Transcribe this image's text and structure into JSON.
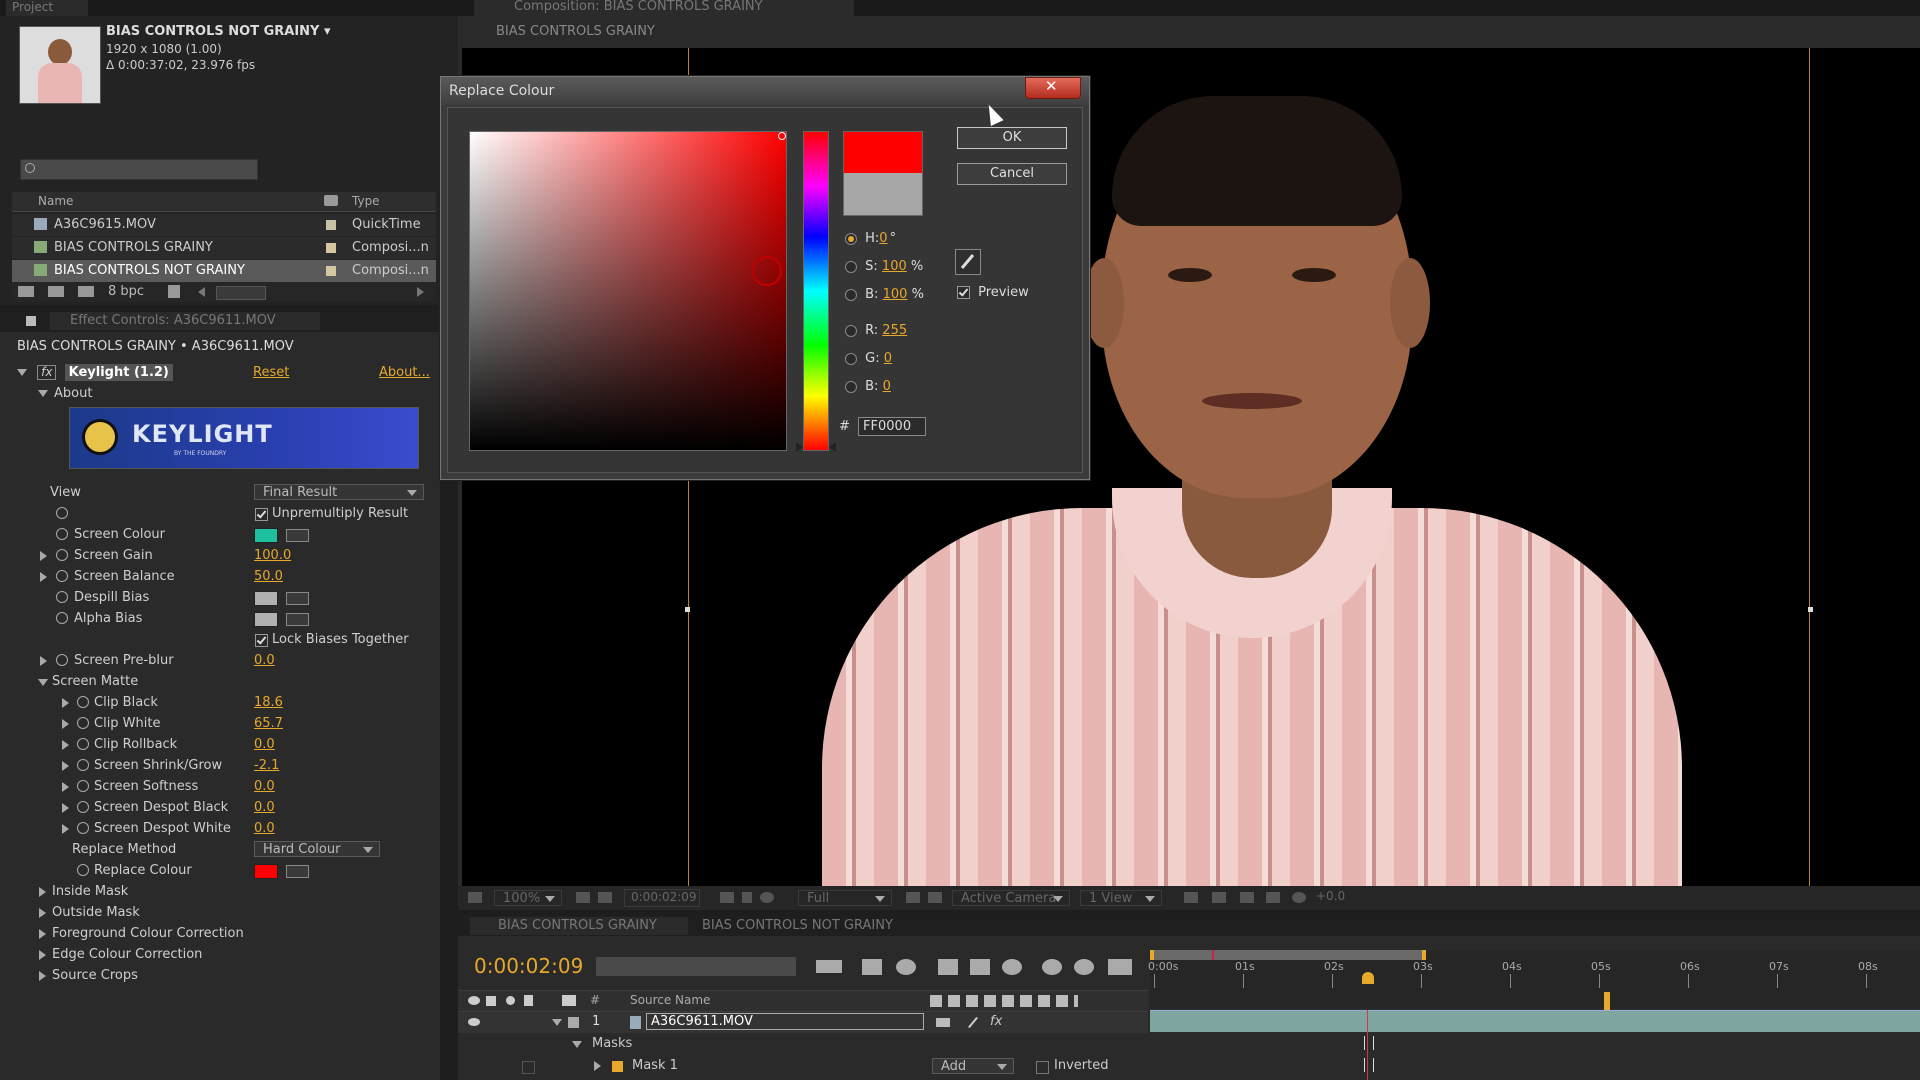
{
  "project": {
    "tab_label": "Project",
    "comp_name": "BIAS CONTROLS NOT GRAINY ▾",
    "comp_size": "1920 x 1080 (1.00)",
    "comp_duration": "Δ 0:00:37:02, 23.976 fps",
    "col_name": "Name",
    "col_type": "Type",
    "items": [
      {
        "name": "A36C9615.MOV",
        "type": "QuickTime"
      },
      {
        "name": "BIAS CONTROLS GRAINY",
        "type": "Composi...n"
      },
      {
        "name": "BIAS CONTROLS NOT GRAINY",
        "type": "Composi...n"
      }
    ],
    "bpc": "8 bpc"
  },
  "effect_controls": {
    "tab_label": "Effect Controls: A36C9611.MOV",
    "breadcrumb": "BIAS CONTROLS GRAINY • A36C9611.MOV",
    "effect_name": "Keylight (1.2)",
    "reset": "Reset",
    "about_link": "About...",
    "about_group": "About",
    "logo_text": "KEYLIGHT",
    "logo_sub": "BY THE FOUNDRY",
    "view_label": "View",
    "view_value": "Final Result",
    "unpremultiply": "Unpremultiply Result",
    "screen_colour": "Screen Colour",
    "screen_gain": "Screen Gain",
    "screen_gain_val": "100.0",
    "screen_balance": "Screen Balance",
    "screen_balance_val": "50.0",
    "despill_bias": "Despill Bias",
    "alpha_bias": "Alpha Bias",
    "lock_biases": "Lock Biases Together",
    "screen_preblur": "Screen Pre-blur",
    "screen_preblur_val": "0.0",
    "screen_matte": "Screen Matte",
    "clip_black": "Clip Black",
    "clip_black_val": "18.6",
    "clip_white": "Clip White",
    "clip_white_val": "65.7",
    "clip_rollback": "Clip Rollback",
    "clip_rollback_val": "0.0",
    "shrink_grow": "Screen Shrink/Grow",
    "shrink_grow_val": "-2.1",
    "softness": "Screen Softness",
    "softness_val": "0.0",
    "despot_black": "Screen Despot Black",
    "despot_black_val": "0.0",
    "despot_white": "Screen Despot White",
    "despot_white_val": "0.0",
    "replace_method": "Replace Method",
    "replace_method_val": "Hard Colour",
    "replace_colour": "Replace Colour",
    "inside_mask": "Inside Mask",
    "outside_mask": "Outside Mask",
    "fg_correction": "Foreground Colour Correction",
    "edge_correction": "Edge Colour Correction",
    "source_crops": "Source Crops"
  },
  "composition": {
    "tab_label": "Composition: BIAS CONTROLS GRAINY",
    "subtab": "BIAS CONTROLS GRAINY",
    "zoom": "100%",
    "timecode": "0:00:02:09",
    "resolution": "Full",
    "camera": "Active Camera",
    "views": "1 View",
    "exposure": "+0.0"
  },
  "dialog": {
    "title": "Replace Colour",
    "ok": "OK",
    "cancel": "Cancel",
    "h_label": "H:",
    "h_val": "0",
    "h_unit": "°",
    "s_label": "S:",
    "s_val": "100",
    "b_label": "B:",
    "b_val": "100",
    "pct": "%",
    "r_label": "R:",
    "r_val": "255",
    "g_label": "G:",
    "g_val": "0",
    "bl_label": "B:",
    "bl_val": "0",
    "hash": "#",
    "hex": "FF0000",
    "preview": "Preview",
    "new_color": "#ff0000",
    "old_color": "#a6a6a6"
  },
  "timeline": {
    "tab1": "BIAS CONTROLS GRAINY",
    "tab2": "BIAS CONTROLS NOT GRAINY",
    "timecode": "0:00:02:09",
    "col_hash": "#",
    "col_source": "Source Name",
    "layer_num": "1",
    "layer_name": "A36C9611.MOV",
    "masks": "Masks",
    "mask1": "Mask 1",
    "mode": "Add",
    "inverted": "Inverted",
    "ruler": [
      "0:00s",
      "01s",
      "02s",
      "03s",
      "04s",
      "05s",
      "06s",
      "07s",
      "08s"
    ]
  },
  "colors": {
    "accent": "#e6a92c",
    "screen_colour": "#1fc0a0",
    "replace_colour": "#ff0000",
    "bias_grey": "#b0b0b0"
  }
}
